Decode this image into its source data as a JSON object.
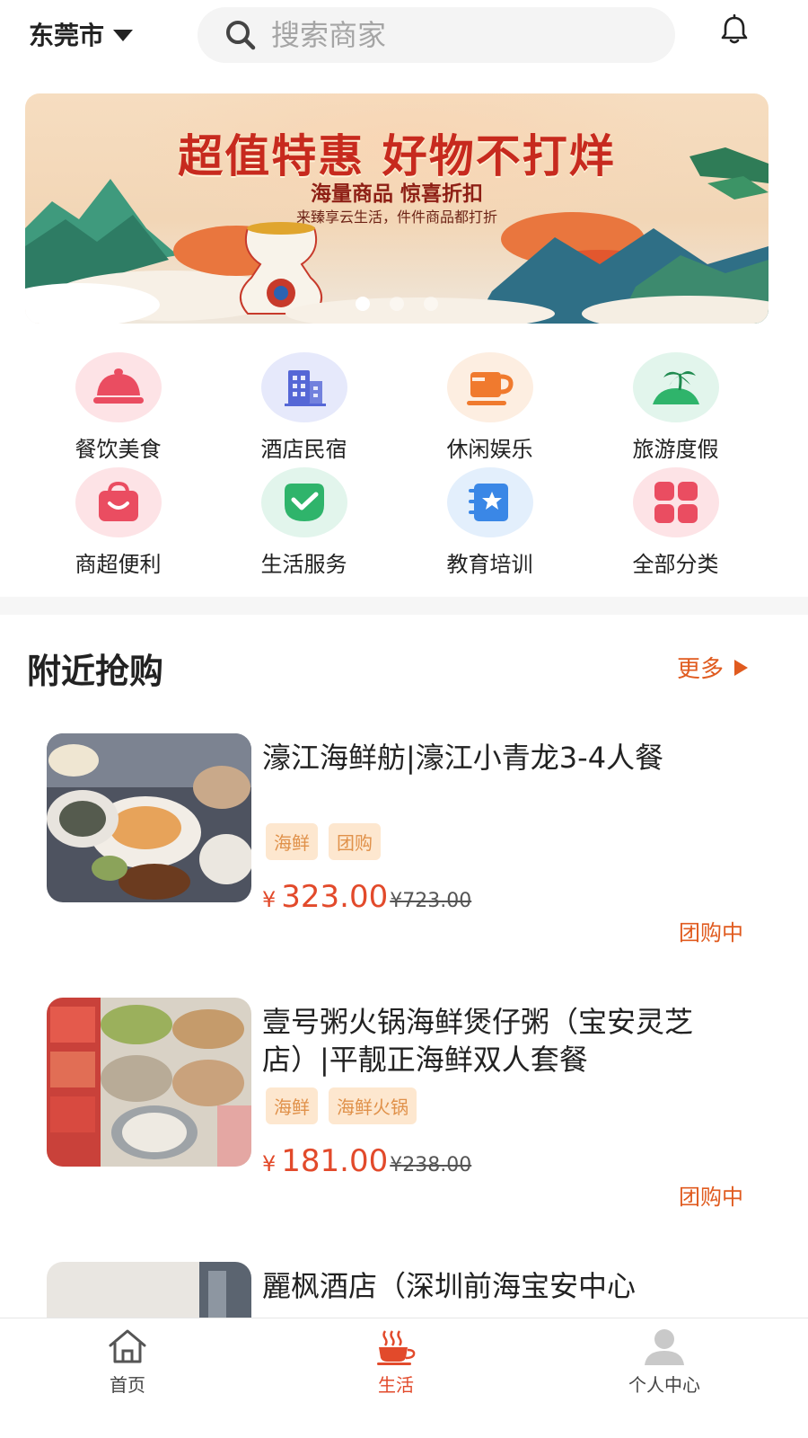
{
  "header": {
    "city": "东莞市",
    "search_placeholder": "搜索商家"
  },
  "banner": {
    "title": "超值特惠 好物不打烊",
    "subtitle": "海量商品 惊喜折扣",
    "tagline": "来臻享云生活，件件商品都打折",
    "slide_count": 3,
    "active_slide": 1
  },
  "categories": [
    {
      "label": "餐饮美食",
      "icon": "dining-cloche-icon",
      "bg": "#fde3e6",
      "color": "#ea4d61"
    },
    {
      "label": "酒店民宿",
      "icon": "hotel-building-icon",
      "bg": "#e6e9fb",
      "color": "#5567d6"
    },
    {
      "label": "休闲娱乐",
      "icon": "coffee-cup-icon",
      "bg": "#fdeee1",
      "color": "#f07a2e"
    },
    {
      "label": "旅游度假",
      "icon": "palm-island-icon",
      "bg": "#e2f5ec",
      "color": "#2fb46b"
    },
    {
      "label": "商超便利",
      "icon": "shopping-bag-icon",
      "bg": "#fde3e6",
      "color": "#ea4d61"
    },
    {
      "label": "生活服务",
      "icon": "check-badge-icon",
      "bg": "#e2f5ec",
      "color": "#2fb46b"
    },
    {
      "label": "教育培训",
      "icon": "star-book-icon",
      "bg": "#e3effc",
      "color": "#3a87e6"
    },
    {
      "label": "全部分类",
      "icon": "grid-squares-icon",
      "bg": "#fde3e6",
      "color": "#ea4d61"
    }
  ],
  "section": {
    "title": "附近抢购",
    "more_label": "更多"
  },
  "deals": [
    {
      "name": "濠江海鲜舫|濠江小青龙3-4人餐",
      "tags": [
        "海鲜",
        "团购"
      ],
      "currency": "¥",
      "price": "323.00",
      "original_price": "¥723.00",
      "status": "团购中"
    },
    {
      "name": "壹号粥火锅海鲜煲仔粥（宝安灵芝店）|平靓正海鲜双人套餐",
      "tags": [
        "海鲜",
        "海鲜火锅"
      ],
      "currency": "¥",
      "price": "181.00",
      "original_price": "¥238.00",
      "status": "团购中"
    },
    {
      "name": "麗枫酒店（深圳前海宝安中心"
    }
  ],
  "nav": {
    "home": "首页",
    "life": "生活",
    "profile": "个人中心",
    "active": "life",
    "accent": "#e24a2b"
  }
}
